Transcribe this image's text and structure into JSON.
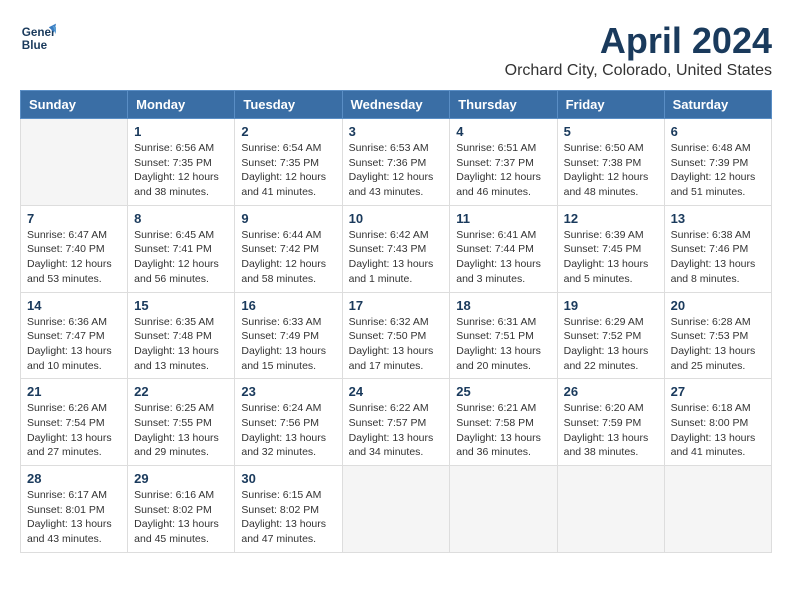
{
  "logo": {
    "line1": "General",
    "line2": "Blue"
  },
  "title": "April 2024",
  "subtitle": "Orchard City, Colorado, United States",
  "days_of_week": [
    "Sunday",
    "Monday",
    "Tuesday",
    "Wednesday",
    "Thursday",
    "Friday",
    "Saturday"
  ],
  "weeks": [
    [
      {
        "day": "",
        "empty": true
      },
      {
        "day": "1",
        "sunrise": "6:56 AM",
        "sunset": "7:35 PM",
        "daylight": "12 hours and 38 minutes."
      },
      {
        "day": "2",
        "sunrise": "6:54 AM",
        "sunset": "7:35 PM",
        "daylight": "12 hours and 41 minutes."
      },
      {
        "day": "3",
        "sunrise": "6:53 AM",
        "sunset": "7:36 PM",
        "daylight": "12 hours and 43 minutes."
      },
      {
        "day": "4",
        "sunrise": "6:51 AM",
        "sunset": "7:37 PM",
        "daylight": "12 hours and 46 minutes."
      },
      {
        "day": "5",
        "sunrise": "6:50 AM",
        "sunset": "7:38 PM",
        "daylight": "12 hours and 48 minutes."
      },
      {
        "day": "6",
        "sunrise": "6:48 AM",
        "sunset": "7:39 PM",
        "daylight": "12 hours and 51 minutes."
      }
    ],
    [
      {
        "day": "7",
        "sunrise": "6:47 AM",
        "sunset": "7:40 PM",
        "daylight": "12 hours and 53 minutes."
      },
      {
        "day": "8",
        "sunrise": "6:45 AM",
        "sunset": "7:41 PM",
        "daylight": "12 hours and 56 minutes."
      },
      {
        "day": "9",
        "sunrise": "6:44 AM",
        "sunset": "7:42 PM",
        "daylight": "12 hours and 58 minutes."
      },
      {
        "day": "10",
        "sunrise": "6:42 AM",
        "sunset": "7:43 PM",
        "daylight": "13 hours and 1 minute."
      },
      {
        "day": "11",
        "sunrise": "6:41 AM",
        "sunset": "7:44 PM",
        "daylight": "13 hours and 3 minutes."
      },
      {
        "day": "12",
        "sunrise": "6:39 AM",
        "sunset": "7:45 PM",
        "daylight": "13 hours and 5 minutes."
      },
      {
        "day": "13",
        "sunrise": "6:38 AM",
        "sunset": "7:46 PM",
        "daylight": "13 hours and 8 minutes."
      }
    ],
    [
      {
        "day": "14",
        "sunrise": "6:36 AM",
        "sunset": "7:47 PM",
        "daylight": "13 hours and 10 minutes."
      },
      {
        "day": "15",
        "sunrise": "6:35 AM",
        "sunset": "7:48 PM",
        "daylight": "13 hours and 13 minutes."
      },
      {
        "day": "16",
        "sunrise": "6:33 AM",
        "sunset": "7:49 PM",
        "daylight": "13 hours and 15 minutes."
      },
      {
        "day": "17",
        "sunrise": "6:32 AM",
        "sunset": "7:50 PM",
        "daylight": "13 hours and 17 minutes."
      },
      {
        "day": "18",
        "sunrise": "6:31 AM",
        "sunset": "7:51 PM",
        "daylight": "13 hours and 20 minutes."
      },
      {
        "day": "19",
        "sunrise": "6:29 AM",
        "sunset": "7:52 PM",
        "daylight": "13 hours and 22 minutes."
      },
      {
        "day": "20",
        "sunrise": "6:28 AM",
        "sunset": "7:53 PM",
        "daylight": "13 hours and 25 minutes."
      }
    ],
    [
      {
        "day": "21",
        "sunrise": "6:26 AM",
        "sunset": "7:54 PM",
        "daylight": "13 hours and 27 minutes."
      },
      {
        "day": "22",
        "sunrise": "6:25 AM",
        "sunset": "7:55 PM",
        "daylight": "13 hours and 29 minutes."
      },
      {
        "day": "23",
        "sunrise": "6:24 AM",
        "sunset": "7:56 PM",
        "daylight": "13 hours and 32 minutes."
      },
      {
        "day": "24",
        "sunrise": "6:22 AM",
        "sunset": "7:57 PM",
        "daylight": "13 hours and 34 minutes."
      },
      {
        "day": "25",
        "sunrise": "6:21 AM",
        "sunset": "7:58 PM",
        "daylight": "13 hours and 36 minutes."
      },
      {
        "day": "26",
        "sunrise": "6:20 AM",
        "sunset": "7:59 PM",
        "daylight": "13 hours and 38 minutes."
      },
      {
        "day": "27",
        "sunrise": "6:18 AM",
        "sunset": "8:00 PM",
        "daylight": "13 hours and 41 minutes."
      }
    ],
    [
      {
        "day": "28",
        "sunrise": "6:17 AM",
        "sunset": "8:01 PM",
        "daylight": "13 hours and 43 minutes."
      },
      {
        "day": "29",
        "sunrise": "6:16 AM",
        "sunset": "8:02 PM",
        "daylight": "13 hours and 45 minutes."
      },
      {
        "day": "30",
        "sunrise": "6:15 AM",
        "sunset": "8:02 PM",
        "daylight": "13 hours and 47 minutes."
      },
      {
        "day": "",
        "empty": true
      },
      {
        "day": "",
        "empty": true
      },
      {
        "day": "",
        "empty": true
      },
      {
        "day": "",
        "empty": true
      }
    ]
  ],
  "labels": {
    "sunrise_prefix": "Sunrise: ",
    "sunset_prefix": "Sunset: ",
    "daylight_prefix": "Daylight: "
  }
}
